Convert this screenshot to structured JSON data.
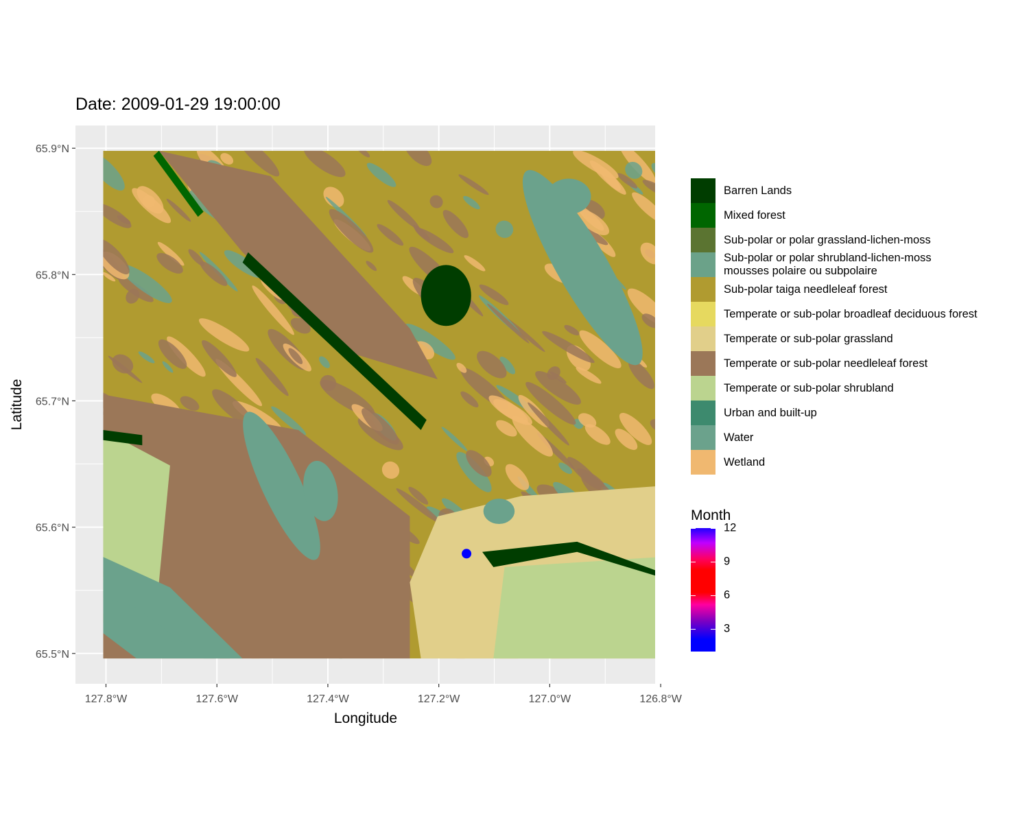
{
  "title": "Date: 2009-01-29 19:00:00",
  "axes": {
    "xlabel": "Longitude",
    "ylabel": "Latitude",
    "x_ticks": [
      {
        "value": -127.8,
        "label": "127.8°W"
      },
      {
        "value": -127.6,
        "label": "127.6°W"
      },
      {
        "value": -127.4,
        "label": "127.4°W"
      },
      {
        "value": -127.2,
        "label": "127.2°W"
      },
      {
        "value": -127.0,
        "label": "127.0°W"
      },
      {
        "value": -126.8,
        "label": "126.8°W"
      }
    ],
    "y_ticks": [
      {
        "value": 65.9,
        "label": "65.9°N"
      },
      {
        "value": 65.8,
        "label": "65.8°N"
      },
      {
        "value": 65.7,
        "label": "65.7°N"
      },
      {
        "value": 65.6,
        "label": "65.6°N"
      },
      {
        "value": 65.5,
        "label": "65.5°N"
      }
    ],
    "xlim": [
      -127.855,
      -126.81
    ],
    "ylim": [
      65.476,
      65.918
    ]
  },
  "raster_extent": {
    "lon": [
      -127.805,
      -126.8
    ],
    "lat": [
      65.496,
      65.898
    ]
  },
  "landcover_legend": [
    {
      "label": "Barren Lands",
      "color": "#003d00"
    },
    {
      "label": "Mixed forest",
      "color": "#006600"
    },
    {
      "label": "Sub-polar or polar grassland-lichen-moss",
      "color": "#5b7431"
    },
    {
      "label": "Sub-polar or polar shrubland-lichen-moss\nmousses polaire ou subpolaire",
      "color": "#6ba289"
    },
    {
      "label": "Sub-polar taiga needleleaf forest",
      "color": "#b09b30"
    },
    {
      "label": "Temperate or sub-polar broadleaf deciduous forest",
      "color": "#e6d95f"
    },
    {
      "label": "Temperate or sub-polar grassland",
      "color": "#e1cf8a"
    },
    {
      "label": "Temperate or sub-polar needleleaf forest",
      "color": "#9b7758"
    },
    {
      "label": "Temperate or sub-polar shrubland",
      "color": "#bbd48f"
    },
    {
      "label": "Urban and built-up",
      "color": "#3d8a6e"
    },
    {
      "label": "Water",
      "color": "#6ba28c"
    },
    {
      "label": "Wetland",
      "color": "#f0b870"
    }
  ],
  "month_legend": {
    "title": "Month",
    "ticks": [
      "3",
      "6",
      "9",
      "12"
    ],
    "tick_values": [
      3,
      6,
      9,
      12
    ],
    "range": [
      1,
      12
    ],
    "colors": [
      "#0000ff",
      "#ff0000",
      "#ff0000",
      "#0000ff"
    ]
  },
  "chart_data": {
    "type": "scatter",
    "title": "Date: 2009-01-29 19:00:00",
    "xlabel": "Longitude",
    "ylabel": "Latitude",
    "xlim": [
      -127.855,
      -126.81
    ],
    "ylim": [
      65.476,
      65.918
    ],
    "points": [
      {
        "lon": -127.15,
        "lat": 65.579,
        "month": 1,
        "color": "#0000ff"
      }
    ],
    "grid": true
  }
}
